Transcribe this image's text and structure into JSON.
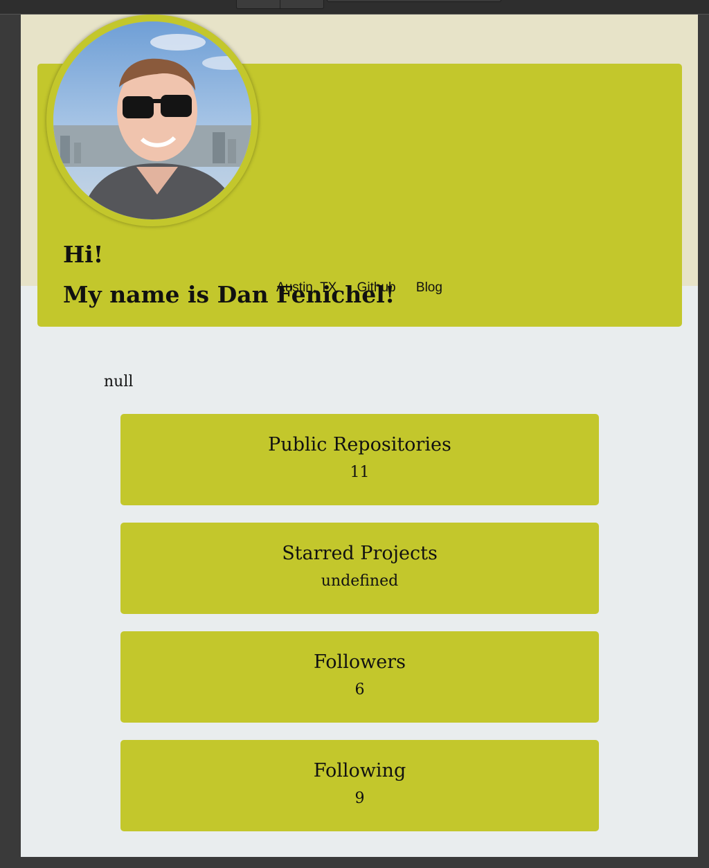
{
  "hero": {
    "greeting_line1": "Hi!",
    "greeting_line2": "My name is Dan Fenichel!",
    "links": {
      "location": "Austin, TX",
      "github": "Github",
      "blog": "Blog"
    }
  },
  "bio": "null",
  "stats": [
    {
      "title": "Public Repositories",
      "value": "11"
    },
    {
      "title": "Starred Projects",
      "value": "undefined"
    },
    {
      "title": "Followers",
      "value": "6"
    },
    {
      "title": "Following",
      "value": "9"
    }
  ],
  "colors": {
    "accent": "#c3c72c",
    "header_band": "#e7e3c8",
    "page_background": "#e9edee",
    "text": "#111111"
  },
  "icons": {
    "avatar": "profile-photo"
  }
}
